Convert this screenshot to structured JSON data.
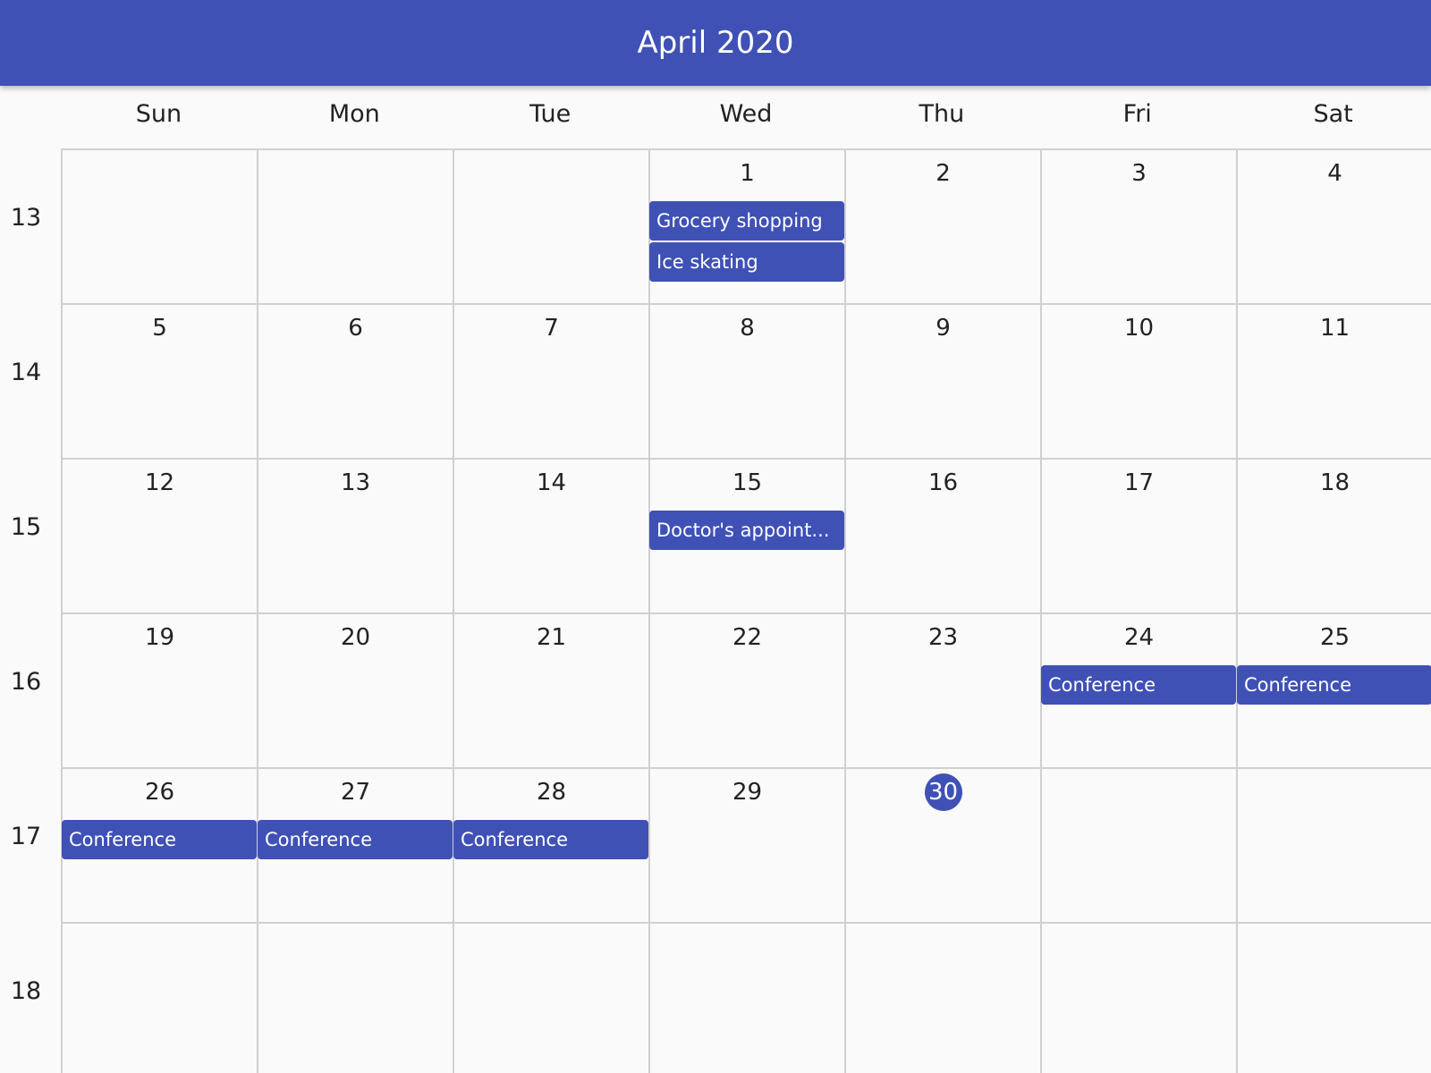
{
  "header": {
    "title": "April 2020"
  },
  "weekdays": [
    "Sun",
    "Mon",
    "Tue",
    "Wed",
    "Thu",
    "Fri",
    "Sat"
  ],
  "weeks": [
    {
      "label": "13",
      "days": [
        "",
        "",
        "",
        "1",
        "2",
        "3",
        "4"
      ]
    },
    {
      "label": "14",
      "days": [
        "5",
        "6",
        "7",
        "8",
        "9",
        "10",
        "11"
      ]
    },
    {
      "label": "15",
      "days": [
        "12",
        "13",
        "14",
        "15",
        "16",
        "17",
        "18"
      ]
    },
    {
      "label": "16",
      "days": [
        "19",
        "20",
        "21",
        "22",
        "23",
        "24",
        "25"
      ]
    },
    {
      "label": "17",
      "days": [
        "26",
        "27",
        "28",
        "29",
        "30",
        "",
        ""
      ]
    },
    {
      "label": "18",
      "days": [
        "",
        "",
        "",
        "",
        "",
        "",
        ""
      ]
    }
  ],
  "today": "30",
  "colors": {
    "accent": "#3f51b5",
    "grid": "#d0d0d0",
    "background": "#fafafa"
  },
  "events": [
    {
      "title": "Grocery shopping",
      "week": 0,
      "day": 3,
      "slot": 0
    },
    {
      "title": "Ice skating",
      "week": 0,
      "day": 3,
      "slot": 1
    },
    {
      "title": "Doctor's appoint...",
      "week": 2,
      "day": 3,
      "slot": 0
    },
    {
      "title": "Conference",
      "week": 3,
      "day": 5,
      "slot": 0
    },
    {
      "title": "Conference",
      "week": 3,
      "day": 6,
      "slot": 0
    },
    {
      "title": "Conference",
      "week": 4,
      "day": 0,
      "slot": 0
    },
    {
      "title": "Conference",
      "week": 4,
      "day": 1,
      "slot": 0
    },
    {
      "title": "Conference",
      "week": 4,
      "day": 2,
      "slot": 0
    }
  ]
}
